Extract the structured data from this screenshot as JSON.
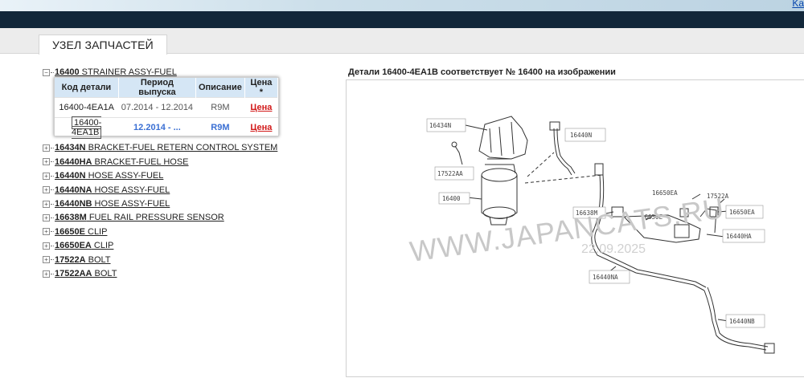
{
  "header": {
    "top_link": "Ka"
  },
  "tab": {
    "label": "УЗЕЛ ЗАПЧАСТЕЙ"
  },
  "tree": {
    "expanded": {
      "toggle": "−",
      "code": "16400",
      "name": " STRAINER ASSY-FUEL"
    },
    "items": [
      {
        "code": "16434N",
        "name": " BRACKET-FUEL RETERN CONTROL SYSTEM"
      },
      {
        "code": "16440HA",
        "name": " BRACKET-FUEL HOSE"
      },
      {
        "code": "16440N",
        "name": " HOSE ASSY-FUEL"
      },
      {
        "code": "16440NA",
        "name": " HOSE ASSY-FUEL"
      },
      {
        "code": "16440NB",
        "name": " HOSE ASSY-FUEL"
      },
      {
        "code": "16638M",
        "name": " FUEL RAIL PRESSURE SENSOR"
      },
      {
        "code": "16650E",
        "name": " CLIP"
      },
      {
        "code": "16650EA",
        "name": " CLIP"
      },
      {
        "code": "17522A",
        "name": " BOLT"
      },
      {
        "code": "17522AA",
        "name": " BOLT"
      }
    ],
    "collapsed_toggle": "+"
  },
  "parts_table": {
    "headers": [
      "Код детали",
      "Период выпуска",
      "Описание",
      "Цена *"
    ],
    "rows": [
      {
        "code": "16400-4EA1A",
        "period": "07.2014 - 12.2014",
        "desc": "R9M",
        "price": "Цена"
      },
      {
        "code": "16400-4EA1B",
        "period": "12.2014 - ...",
        "desc": "R9M",
        "price": "Цена"
      }
    ]
  },
  "diagram": {
    "info": "Детали 16400-4EA1B соответствует № 16400 на изображении",
    "watermark": "WWW.JAPANCATS.RU",
    "watermark_date": "22.09.2025",
    "labels": [
      "16434N",
      "16440N",
      "17522AA",
      "16400",
      "16638M",
      "16650EA",
      "17522A",
      "16650EA",
      "16650E",
      "16440HA",
      "16440NA",
      "16440NB"
    ]
  }
}
